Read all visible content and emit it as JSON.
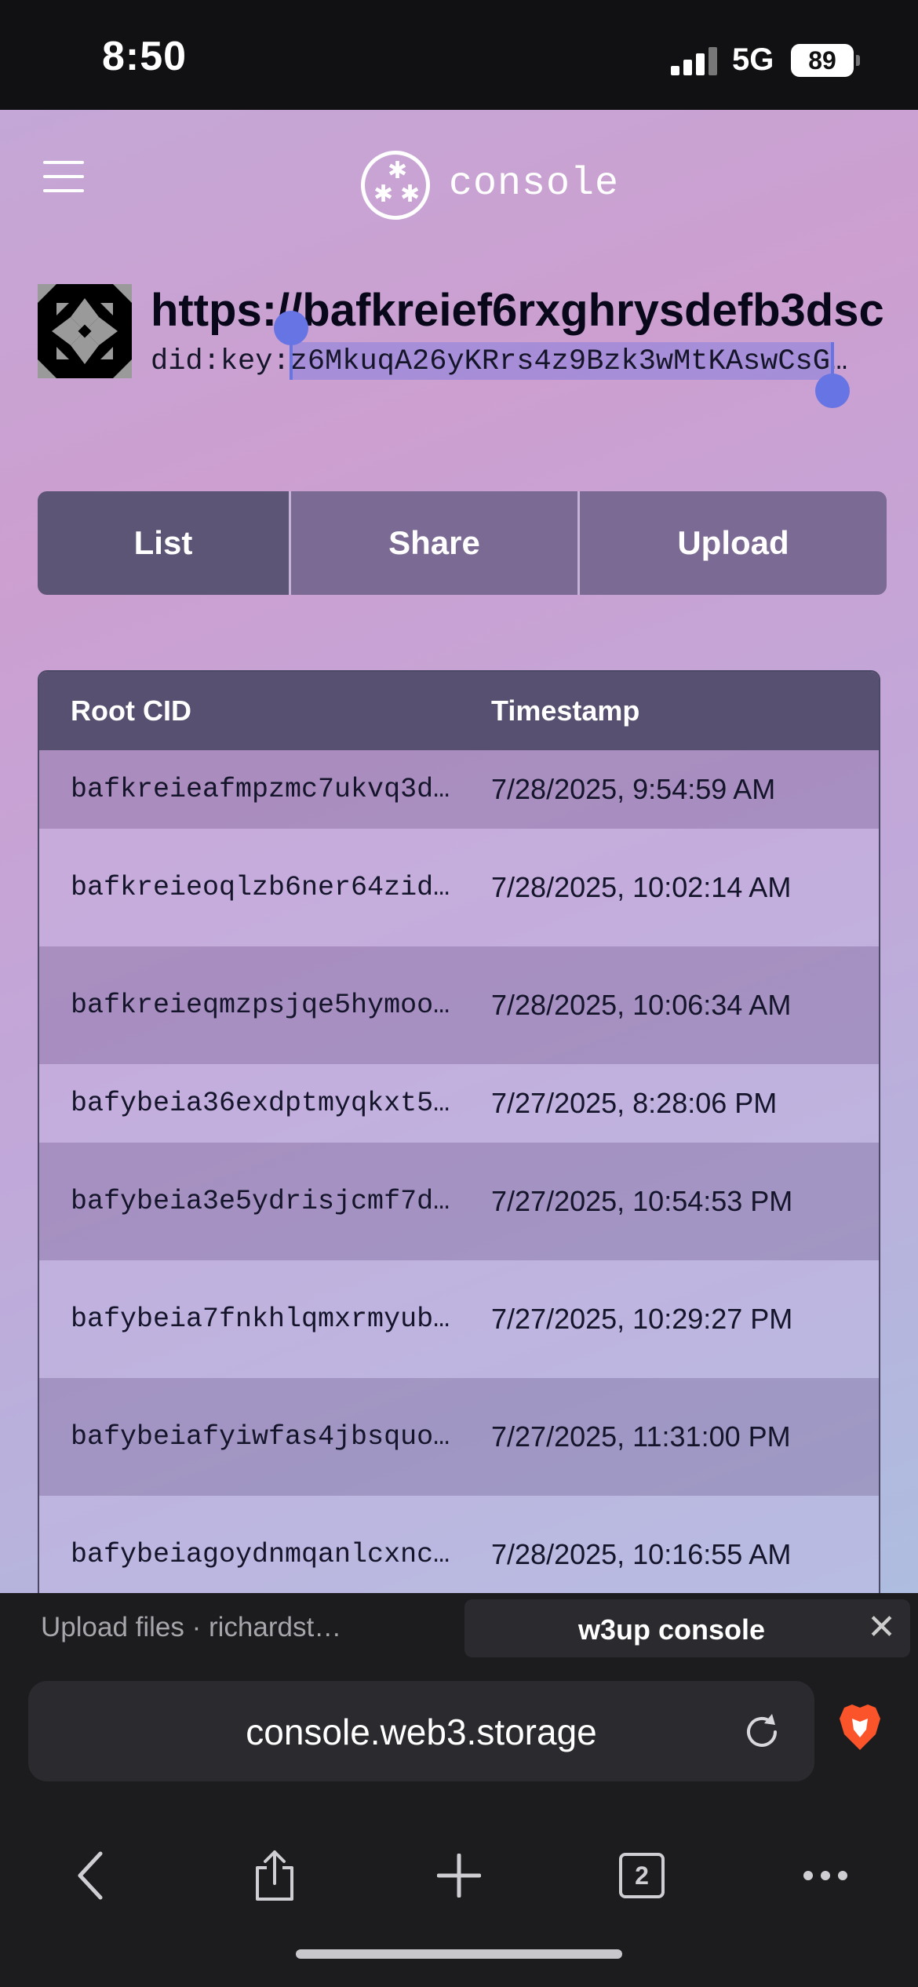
{
  "status_bar": {
    "time": "8:50",
    "network": "5G",
    "battery": "89"
  },
  "header": {
    "brand": "console",
    "menu_icon": "hamburger-menu-icon",
    "logo_icon": "w3-logo-icon"
  },
  "space": {
    "name": "https://bafkreief6rxghrysdefb3dsc",
    "did": "did:key:z6MkuqA26yKRrs4z9Bzk3wMtKAswCsG…"
  },
  "tabs": [
    {
      "label": "List",
      "active": true
    },
    {
      "label": "Share",
      "active": false
    },
    {
      "label": "Upload",
      "active": false
    }
  ],
  "uploads_table": {
    "headers": {
      "root_cid": "Root CID",
      "timestamp": "Timestamp"
    },
    "rows": [
      {
        "root_cid": "bafkreieafmpzmc7ukvq3d…",
        "timestamp": "7/28/2025, 9:54:59 AM"
      },
      {
        "root_cid": "bafkreieoqlzb6ner64zid…",
        "timestamp": "7/28/2025, 10:02:14 AM"
      },
      {
        "root_cid": "bafkreieqmzpsjqe5hymoo…",
        "timestamp": "7/28/2025, 10:06:34 AM"
      },
      {
        "root_cid": "bafybeia36exdptmyqkxt5…",
        "timestamp": "7/27/2025, 8:28:06 PM"
      },
      {
        "root_cid": "bafybeia3e5ydrisjcmf7d…",
        "timestamp": "7/27/2025, 10:54:53 PM"
      },
      {
        "root_cid": "bafybeia7fnkhlqmxrmyub…",
        "timestamp": "7/27/2025, 10:29:27 PM"
      },
      {
        "root_cid": "bafybeiafyiwfas4jbsquo…",
        "timestamp": "7/27/2025, 11:31:00 PM"
      },
      {
        "root_cid": "bafybeiagoydnmqanlcxnc…",
        "timestamp": "7/28/2025, 10:16:55 AM"
      }
    ]
  },
  "browser": {
    "tabs": [
      {
        "title": "Upload files · richardst…",
        "active": false
      },
      {
        "title": "w3up console",
        "active": true
      }
    ],
    "url": "console.web3.storage",
    "tab_count": "2"
  },
  "colors": {
    "tab_active": "#5c5575",
    "tab_inactive": "#7b6a93",
    "selection": "#6674e4",
    "table_header": "#585070"
  }
}
